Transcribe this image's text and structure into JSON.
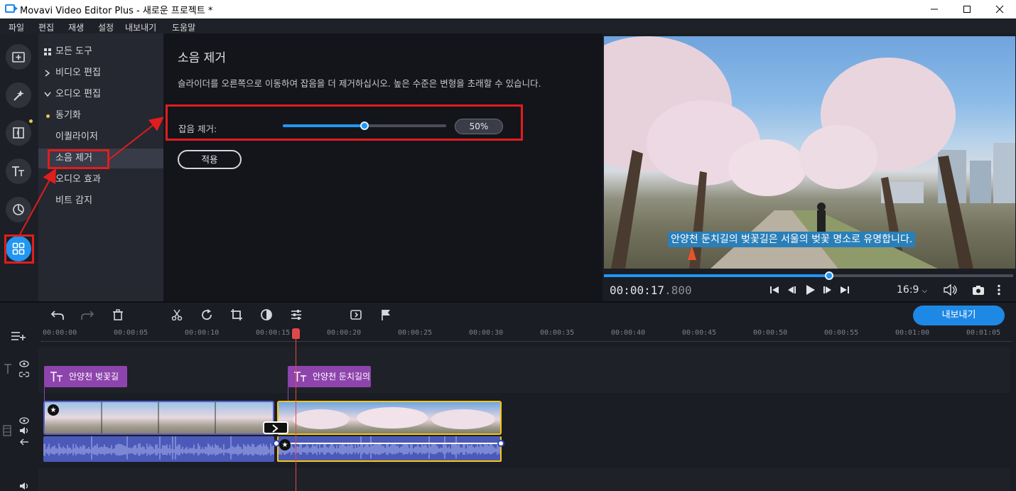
{
  "window": {
    "title": "Movavi Video Editor Plus - 새로운 프로젝트 *"
  },
  "menu": [
    "파일",
    "편집",
    "재생",
    "설정",
    "내보내기",
    "도움말"
  ],
  "rail": {
    "icons": [
      "import-icon",
      "magic-wand-icon",
      "transition-icon",
      "titles-icon",
      "sticker-icon",
      "more-tools-icon"
    ],
    "active": "more-tools-icon"
  },
  "tools": {
    "all_tools": "모든 도구",
    "video_edit": "비디오 편집",
    "audio_edit": "오디오 편집",
    "sync": "동기화",
    "equalizer": "이퀄라이저",
    "noise_removal": "소음 제거",
    "audio_effects": "오디오 효과",
    "beat_detect": "비트 감지"
  },
  "panel": {
    "title": "소음 제거",
    "description": "슬라이더를 오른쪽으로 이동하여 잡음을 더 제거하십시오. 높은 수준은 변형을 초래할 수 있습니다.",
    "slider_label": "잡음 제거:",
    "slider_value_text": "50%",
    "slider_fraction": 0.5,
    "apply_label": "적용"
  },
  "preview": {
    "subtitle": "안양천 둔치길의 벚꽃길은 서울의 벚꽃 명소로 유명합니다.",
    "timecode_main": "00:00:17",
    "timecode_ms": ".800",
    "progress_fraction": 0.55,
    "aspect_ratio": "16:9"
  },
  "timeline": {
    "export_label": "내보내기",
    "ruler_ticks": [
      "00:00:00",
      "00:00:05",
      "00:00:10",
      "00:00:15",
      "00:00:20",
      "00:00:25",
      "00:00:30",
      "00:00:35",
      "00:00:40",
      "00:00:45",
      "00:00:50",
      "00:00:55",
      "00:01:00",
      "00:01:05"
    ],
    "title_clips": [
      "안양천 벚꽃길",
      "안양천 둔치길의"
    ],
    "colors": {
      "accent": "#1e88e5",
      "title_clip": "#8e44ad",
      "audio_clip": "#4b5ab8",
      "selection": "#f5c518",
      "playhead": "#e04848",
      "annotation": "#e11d1d"
    }
  }
}
